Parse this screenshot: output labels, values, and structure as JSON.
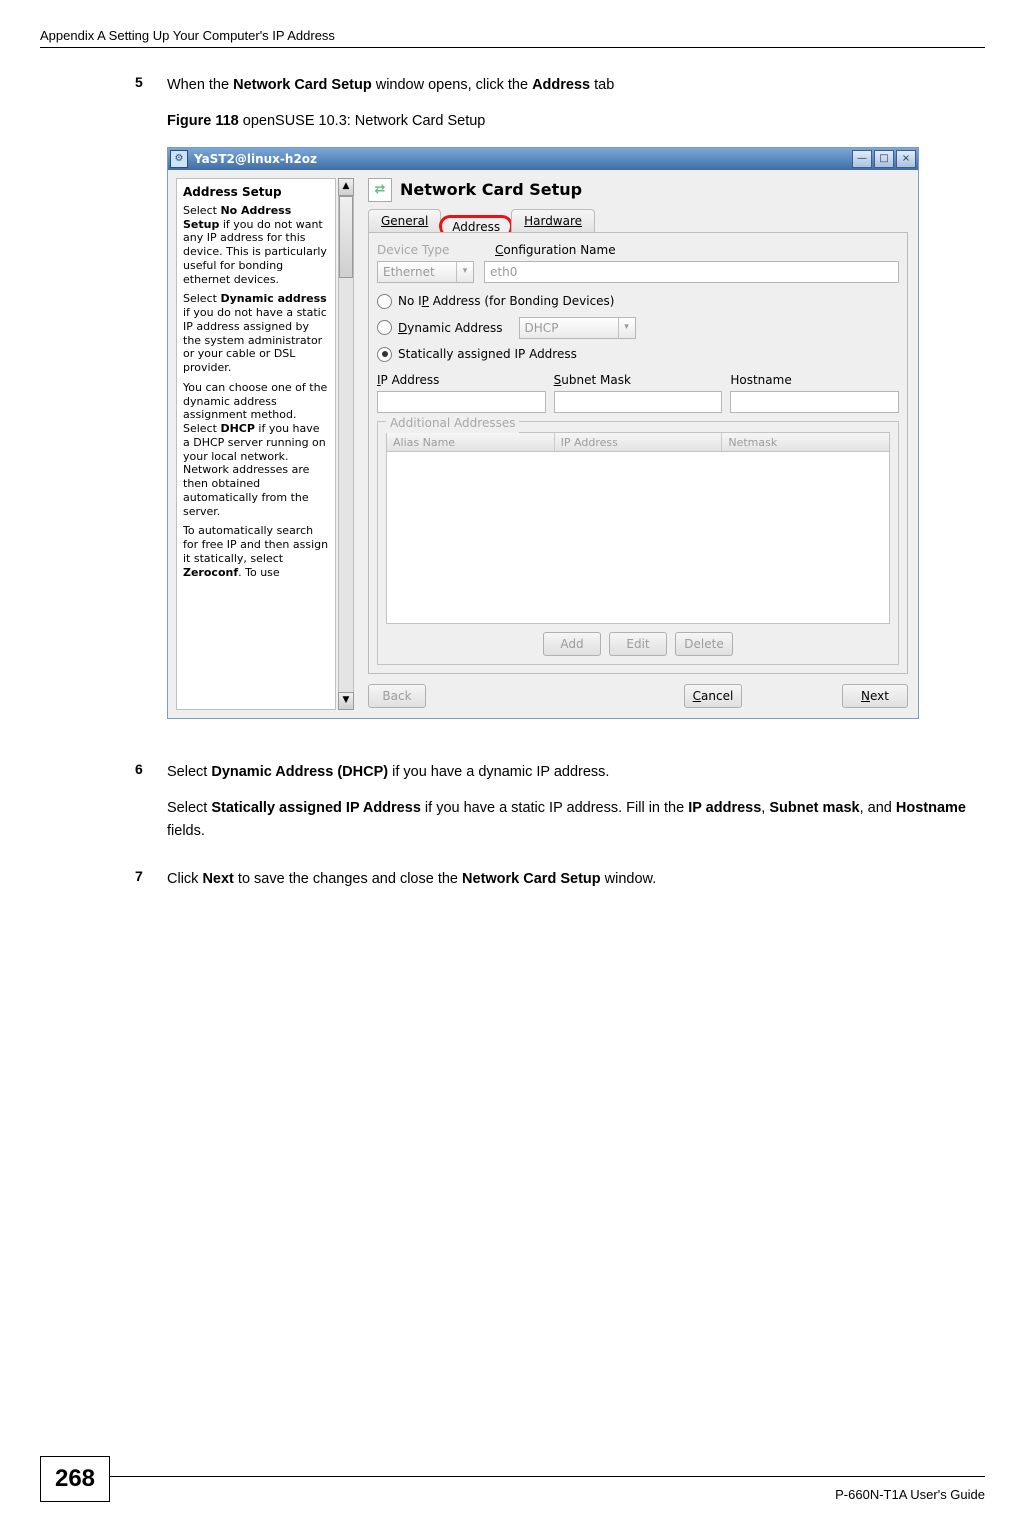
{
  "header": {
    "appendix": "Appendix A Setting Up Your Computer's IP Address"
  },
  "steps": {
    "s5": {
      "num": "5",
      "pre": "When the ",
      "bold1": "Network Card Setup",
      "mid": " window opens, click the ",
      "bold2": "Address",
      "post": " tab"
    },
    "s6": {
      "num": "6",
      "l1_pre": "Select ",
      "l1_bold": "Dynamic Address (DHCP)",
      "l1_post": " if you have a dynamic IP address.",
      "l2_pre": "Select ",
      "l2_bold1": "Statically assigned IP Address",
      "l2_mid": " if you have a static IP address. Fill in the ",
      "l2_bold2": "IP address",
      "l2_sep1": ", ",
      "l2_bold3": "Subnet mask",
      "l2_sep2": ", and ",
      "l2_bold4": "Hostname",
      "l2_post": " fields."
    },
    "s7": {
      "num": "7",
      "pre": "Click ",
      "bold1": "Next",
      "mid": " to save the changes and close the ",
      "bold2": "Network Card Setup",
      "post": " window."
    }
  },
  "figure": {
    "label_pre": "Figure 118",
    "label_post": "   openSUSE 10.3: Network Card Setup"
  },
  "window": {
    "title": "YaST2@linux-h2oz",
    "pane_title": "Network Card Setup",
    "tabs": {
      "general": "General",
      "address": "Address",
      "hardware": "Hardware"
    },
    "device_type_label": "Device Type",
    "config_name_label": "Configuration Name",
    "device_type_value": "Ethernet",
    "config_name_value": "eth0",
    "radio_noip": "No IP Address (for Bonding Devices)",
    "radio_dyn_pre": "D",
    "radio_dyn_rest": "ynamic Address",
    "dyn_combo": "DHCP",
    "radio_static": "Statically assigned IP Address",
    "ip_label_pre": "I",
    "ip_label_rest": "P Address",
    "subnet_label_pre": "S",
    "subnet_label_rest": "ubnet Mask",
    "hostname_label": "Hostname",
    "groupbox": "Additional Addresses",
    "list_headers": {
      "alias": "Alias Name",
      "ip": "IP Address",
      "netmask": "Netmask"
    },
    "buttons": {
      "add": "Add",
      "edit": "Edit",
      "delete": "Delete",
      "back": "Back",
      "cancel": "Cancel",
      "next": "Next"
    },
    "win_btns": {
      "min": "—",
      "max": "□",
      "close": "×"
    }
  },
  "help": {
    "title": "Address Setup",
    "p1_pre": "Select ",
    "p1_bold": "No Address Setup",
    "p1_post": " if you do not want any IP address for this device. This is particularly useful for bonding ethernet devices.",
    "p2_pre": "Select ",
    "p2_bold": "Dynamic address",
    "p2_post": " if you do not have a static IP address assigned by the system administrator or your cable or DSL provider.",
    "p3_pre": "You can choose one of the dynamic address assignment method. Select ",
    "p3_bold": "DHCP",
    "p3_post": " if you have a DHCP server running on your local network. Network addresses are then obtained automatically from the server.",
    "p4_pre": "To automatically search for free IP and then assign it statically, select ",
    "p4_bold": "Zeroconf",
    "p4_post": ". To use"
  },
  "footer": {
    "page_num": "268",
    "guide": "P-660N-T1A User's Guide"
  }
}
